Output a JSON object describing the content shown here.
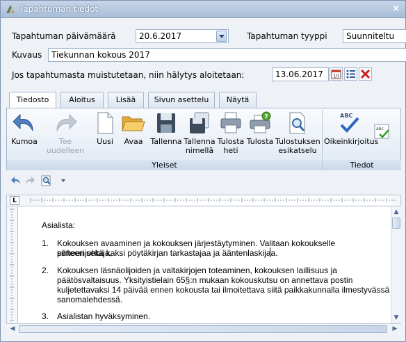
{
  "window": {
    "title": "Tapahtuman tiedot"
  },
  "form": {
    "date_label": "Tapahtuman päivämäärä",
    "date_value": "20.6.2017",
    "type_label": "Tapahtuman tyyppi",
    "type_value": "Suunniteltu",
    "desc_label": "Kuvaus",
    "desc_value": "Tiekunnan kokous 2017",
    "alarm_label": "Jos tapahtumasta muistutetaan, niin hälytys aloitetaan:",
    "alarm_value": "13.06.2017"
  },
  "tabs": [
    "Tiedosto",
    "Aloitus",
    "Lisää",
    "Sivun asettelu",
    "Näytä"
  ],
  "ribbon": {
    "groups": {
      "yleiset": "Yleiset",
      "tiedot": "Tiedot"
    },
    "buttons": {
      "undo": "Kumoa",
      "redo": "Tee uudelleen",
      "new": "Uusi",
      "open": "Avaa",
      "save": "Tallenna",
      "save_as_1": "Tallenna",
      "save_as_2": "nimellä",
      "print_now_1": "Tulosta",
      "print_now_2": "heti",
      "print": "Tulosta",
      "preview_1": "Tulostuksen",
      "preview_2": "esikatselu",
      "spell": "Oikeinkirjoitus",
      "abc_icon": "ABC"
    }
  },
  "ruler": {
    "corner": "L"
  },
  "document": {
    "heading": "Asialista:",
    "items": [
      {
        "num": "1.",
        "lines": [
          "Kokouksen avaaminen ja kokouksen järjestäytyminen. Valitaan kokoukselle puheenjohtaja,",
          "sihteeri sekä kaksi pöytäkirjan tarkastajaa ja ääntenlaskijaa."
        ]
      },
      {
        "num": "2.",
        "lines": [
          "Kokouksen läsnäolijoiden ja valtakirjojen toteaminen, kokouksen laillisuus ja",
          "päätösvaltaisuus. Yksityistielain 65§:n mukaan kokouskutsu on annettava postin",
          "kuljetettavaksi 14 päivää ennen kokousta tai ilmoitettava siitä paikkakunnalla ilmestyvässä",
          "sanomalehdessä."
        ]
      },
      {
        "num": "3.",
        "lines": [
          "Asialistan hyväksyminen."
        ]
      }
    ]
  },
  "colors": {
    "accent": "#2a5a9c",
    "window_bg": "#eef2f7",
    "titlebar": "#b7c9e0"
  }
}
